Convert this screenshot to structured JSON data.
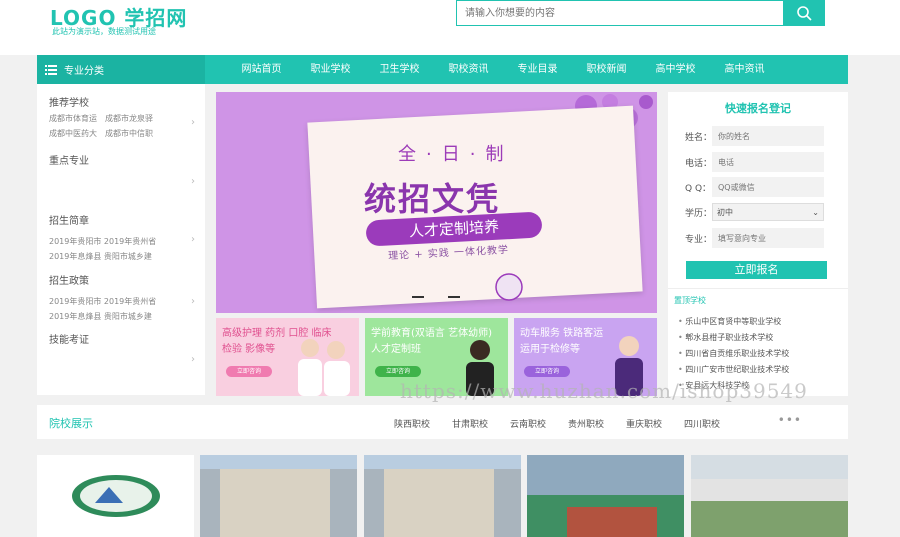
{
  "header": {
    "logo_title": "LOGO 学招网",
    "logo_subtitle": "此站为演示站，数据测试用途",
    "search_placeholder": "请输入你想要的内容"
  },
  "nav": {
    "category_label": "专业分类",
    "items": [
      "网站首页",
      "职业学校",
      "卫生学校",
      "职校资讯",
      "专业目录",
      "职校新闻",
      "高中学校",
      "高中资讯"
    ]
  },
  "sidebar": {
    "sections": [
      {
        "title": "推荐学校",
        "rows": [
          "成都市体育运　成都市龙泉驿",
          "成都中医药大　成都市中信职"
        ]
      },
      {
        "title": "重点专业",
        "rows": []
      },
      {
        "title": "招生简章",
        "rows": [
          "2019年贵阳市 2019年贵州省",
          "2019年息烽县 贵阳市城乡建"
        ]
      },
      {
        "title": "招生政策",
        "rows": [
          "2019年贵阳市 2019年贵州省",
          "2019年息烽县 贵阳市城乡建"
        ]
      },
      {
        "title": "技能考证",
        "rows": []
      }
    ]
  },
  "banner": {
    "top_text": "全·日·制",
    "main_text": "统招文凭",
    "pill_text": "人才定制培养",
    "tagline": "理论 + 实践 一体化教学"
  },
  "promos": [
    {
      "line1": "高级护理 药剂 口腔 临床",
      "line2": "检验 影像等",
      "button": "立即咨询",
      "color": "#f07bb0"
    },
    {
      "line1": "学前教育(双语言 艺体幼师)",
      "line2": "人才定制班",
      "button": "立即咨询",
      "color": "#6bd06f"
    },
    {
      "line1": "动车服务 铁路客运",
      "line2": "运用于检修等",
      "button": "立即咨询",
      "color": "#b07de8"
    }
  ],
  "registration": {
    "title": "快速报名登记",
    "name_label": "姓名：",
    "name_placeholder": "你的姓名",
    "phone_label": "电话：",
    "phone_placeholder": "电话",
    "qq_label": "Q Q：",
    "qq_placeholder": "QQ或微信",
    "edu_label": "学历：",
    "edu_value": "初中",
    "major_label": "专业：",
    "major_placeholder": "填写意向专业",
    "submit_label": "立即报名",
    "list_title": "置顶学校",
    "schools": [
      "乐山中区育贤中等职业学校",
      "郫水县柑子职业技术学校",
      "四川省自贡维乐职业技术学校",
      "四川广安市世纪职业技术学校",
      "安县远大科技学校"
    ]
  },
  "schools_bar": {
    "title": "院校展示",
    "tabs": [
      "陕西职校",
      "甘肃职校",
      "云南职校",
      "贵州职校",
      "重庆职校",
      "四川职校"
    ],
    "more": "•••"
  },
  "watermark": "https://www.huzhan.com/ishop39549",
  "colors": {
    "accent": "#21c3b1",
    "banner_bg": "#cf94e6",
    "banner_text": "#8a35ad"
  }
}
